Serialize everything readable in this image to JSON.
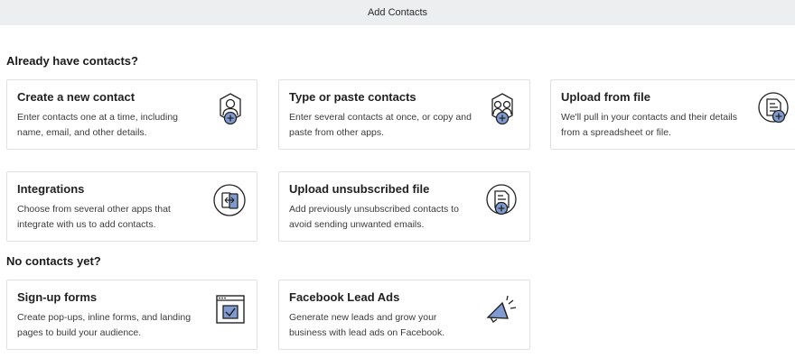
{
  "header": {
    "title": "Add Contacts"
  },
  "sections": {
    "existing": {
      "title": "Already have contacts?"
    },
    "none": {
      "title": "No contacts yet?"
    }
  },
  "cards": {
    "new_contact": {
      "title": "Create a new contact",
      "description": "Enter contacts one at a time, including name, email, and other details.",
      "icon": "person-add-icon"
    },
    "paste_contacts": {
      "title": "Type or paste contacts",
      "description": "Enter several contacts at once, or copy and paste from other apps.",
      "icon": "people-add-icon"
    },
    "upload_file": {
      "title": "Upload from file",
      "description": "We'll pull in your contacts and their details from a spreadsheet or file.",
      "icon": "document-add-icon"
    },
    "integrations": {
      "title": "Integrations",
      "description": "Choose from several other apps that integrate with us to add contacts.",
      "icon": "integrations-icon"
    },
    "unsubscribed": {
      "title": "Upload unsubscribed file",
      "description": "Add previously unsubscribed contacts to avoid sending unwanted emails.",
      "icon": "document-add-icon"
    },
    "signup_forms": {
      "title": "Sign-up forms",
      "description": "Create pop-ups, inline forms, and landing pages to build your audience.",
      "icon": "form-checkbox-icon"
    },
    "facebook_ads": {
      "title": "Facebook Lead Ads",
      "description": "Generate new leads and grow your business with lead ads on Facebook.",
      "icon": "megaphone-icon"
    }
  },
  "colors": {
    "icon_accent": "#7f9bd0",
    "icon_stroke": "#222222",
    "border": "#dfe1e3",
    "header_bg": "#eceef0"
  }
}
